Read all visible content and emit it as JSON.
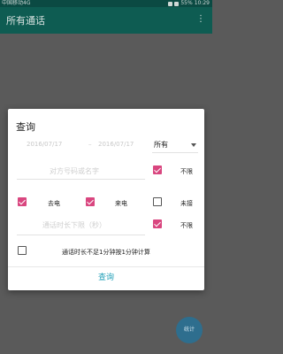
{
  "status": {
    "carrier": "中国移动4G",
    "battery": "55%",
    "time": "10:29"
  },
  "appbar": {
    "title": "所有通话"
  },
  "dialog": {
    "title": "查询",
    "start_date": "2016/07/17",
    "end_date": "2016/07/17",
    "date_separator": "–",
    "type_select": "所有",
    "number_placeholder": "对方号码或名字",
    "unlimited_number_label": "不限",
    "unlimited_number_checked": true,
    "outgoing_label": "去电",
    "outgoing_checked": true,
    "incoming_label": "来电",
    "incoming_checked": true,
    "missed_label": "未接",
    "missed_checked": false,
    "duration_placeholder": "通话时长下限（秒）",
    "unlimited_duration_label": "不限",
    "unlimited_duration_checked": true,
    "round_minute_label": "通话时长不足1分钟按1分钟计算",
    "round_minute_checked": false,
    "query_button": "查询"
  },
  "fab": {
    "label": "统计"
  },
  "colors": {
    "primary": "#0e5c52",
    "accent": "#d9467f",
    "link": "#23a0b8"
  }
}
